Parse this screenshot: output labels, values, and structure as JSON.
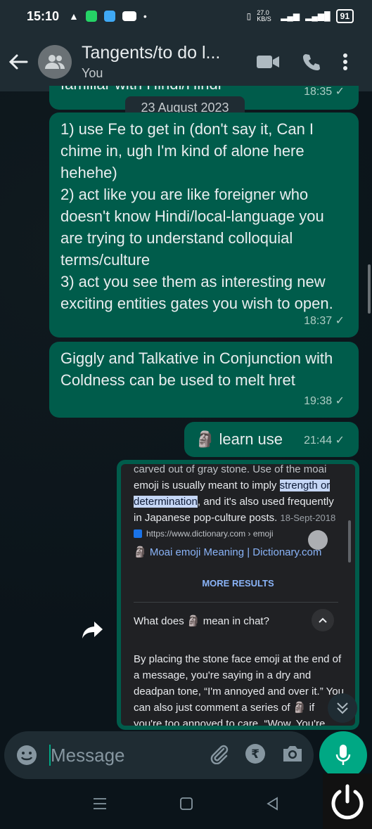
{
  "status": {
    "time": "15:10",
    "net_speed": "27.0 KB/S",
    "battery": "91"
  },
  "header": {
    "title": "Tangents/to do l...",
    "subtitle": "You"
  },
  "date_separator": "23 August 2023",
  "messages": [
    {
      "text": "familiar with Hindi/Hindi",
      "time": "18:35 ✓"
    },
    {
      "text": "1) use Fe to get in (don't say it, Can I chime in, ugh I'm kind of alone here hehehe)\n2) act like you are like foreigner who doesn't know Hindi/local-language you are trying to understand colloquial terms/culture\n3) act you see them as interesting new exciting entities gates you wish to open.",
      "time": "18:37 ✓"
    },
    {
      "text": "Giggly and Talkative in Conjunction with Coldness can be used to melt hret",
      "time": "19:38 ✓"
    },
    {
      "text": "🗿 learn use",
      "time": "21:44 ✓"
    }
  ],
  "image_message": {
    "line_top": "carved out of gray stone. Use of the moai",
    "para_before": "emoji is usually meant to imply ",
    "highlight": "strength or determination",
    "para_after": ", and it's also used frequently in Japanese pop-culture posts.",
    "para_date": "18-Sept-2018",
    "source_url": "https://www.dictionary.com › emoji",
    "source_link": "🗿 Moai emoji Meaning | Dictionary.com",
    "more_results": "MORE RESULTS",
    "question": "What does 🗿 mean in chat?",
    "answer": "By placing the stone face emoji at the end of a message, you're saying in a dry and deadpan tone, “I'm annoyed and over it.” You can also just comment a series of 🗿 if you're too annoyed to care. “Wow. You're such a"
  },
  "input": {
    "placeholder": "Message"
  },
  "colors": {
    "bubble_out": "#005c4b",
    "header_bg": "#1f2c33",
    "accent": "#00a884",
    "bg": "#0b141a"
  }
}
